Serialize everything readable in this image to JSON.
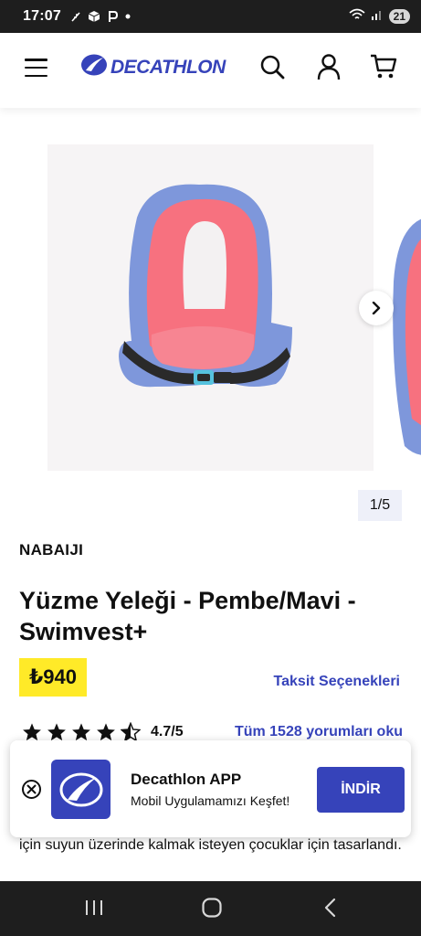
{
  "status_bar": {
    "time": "17:07",
    "battery": "21"
  },
  "header": {
    "logo_text": "DECATHLON",
    "brand_color": "#3643ba",
    "icons": [
      "menu-icon",
      "search-icon",
      "account-icon",
      "cart-icon"
    ]
  },
  "gallery": {
    "counter": "1/5",
    "image_colors": {
      "vest_pink": "#f7717f",
      "vest_blue": "#7e97db",
      "strap": "#2a2a2a",
      "buckle": "#55c2de"
    }
  },
  "product": {
    "brand": "NABAIJI",
    "title": "Yüzme Yeleği - Pembe/Mavi - Swimvest+",
    "price": "₺940",
    "price_badge_color": "#ffea28",
    "installments_label": "Taksit Seçenekleri",
    "rating_stars": 4.5,
    "rating_text": "4.7/5",
    "reviews_link": "Tüm 1528 yorumları oku",
    "description": "için suyun üzerinde kalmak isteyen çocuklar için tasarlandı."
  },
  "app_banner": {
    "app_name": "Decathlon APP",
    "tagline": "Mobil Uygulamamızı Keşfet!",
    "install_label": "İNDİR"
  }
}
